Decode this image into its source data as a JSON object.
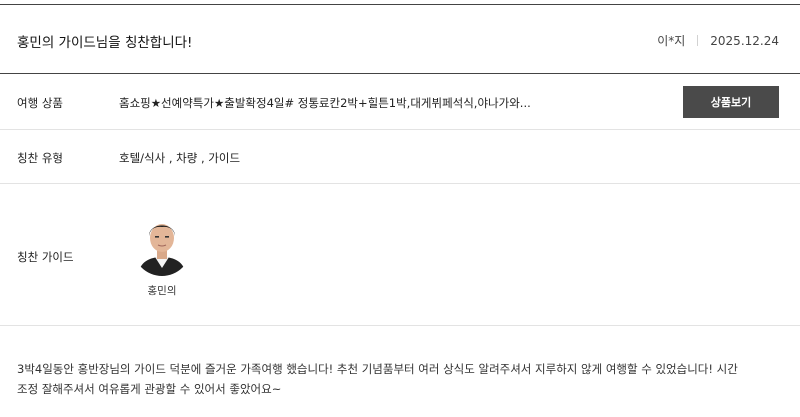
{
  "header": {
    "title": "홍민의 가이드님을 칭찬합니다!",
    "author": "이*지",
    "date": "2025.12.24"
  },
  "product": {
    "label": "여행 상품",
    "name": "홈쇼핑★선예약특가★출발확정4일# 정통료칸2박+힐튼1박,대게뷔페석식,야나가와...",
    "button_label": "상품보기"
  },
  "praise_type": {
    "label": "칭찬 유형",
    "value": "호텔/식사 , 차량 , 가이드"
  },
  "guide": {
    "label": "칭찬 가이드",
    "name": "홍민의"
  },
  "review": {
    "line1": "3박4일동안 홍반장님의 가이드 덕분에 즐거운 가족여행 했습니다! 추천 기념품부터 여러 상식도 알려주셔서 지루하지 않게 여행할 수 있었습니다! 시간",
    "line2": "조정 잘해주셔서 여유롭게 관광할 수 있어서 좋았어요~"
  }
}
